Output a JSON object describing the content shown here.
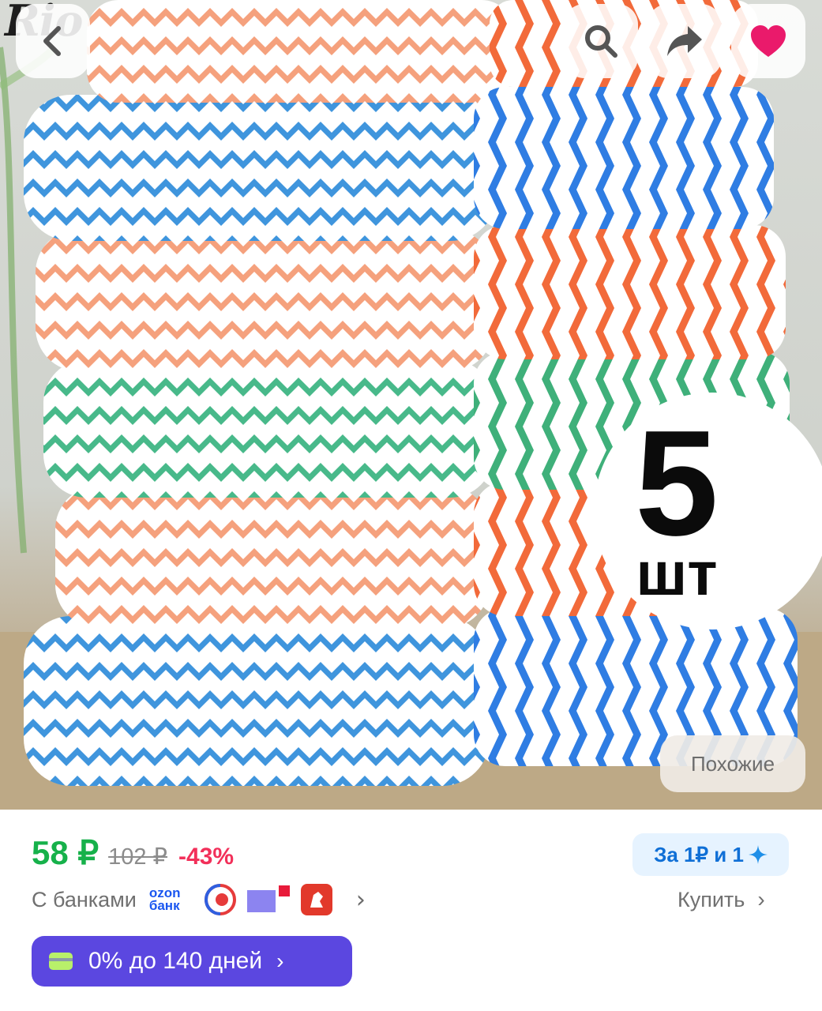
{
  "product": {
    "image_watermark": "Rio",
    "pack_count": "5",
    "pack_unit": "шт",
    "similar_label": "Похожие"
  },
  "toolbar": {
    "back_icon": "chevron-left-icon",
    "search_icon": "search-icon",
    "share_icon": "share-arrow-icon",
    "favorite_icon": "heart-icon",
    "favorite_color": "#ea1a6b"
  },
  "price": {
    "current": "58 ₽",
    "old": "102 ₽",
    "discount": "-43%",
    "current_color": "#16b14a",
    "discount_color": "#f2305a"
  },
  "points_badge": {
    "label": "За 1₽ и 1",
    "icon": "sparkle-icon"
  },
  "banks": {
    "label": "С банками",
    "ozon_bank_line1": "ozon",
    "ozon_bank_line2": "банк",
    "icons": [
      "ozon-bank-logo",
      "alfa-ring-icon",
      "purple-square-icon",
      "red-lion-icon"
    ]
  },
  "buy": {
    "label": "Купить"
  },
  "installment": {
    "label": "0% до 140 дней",
    "color": "#5b47e0"
  }
}
